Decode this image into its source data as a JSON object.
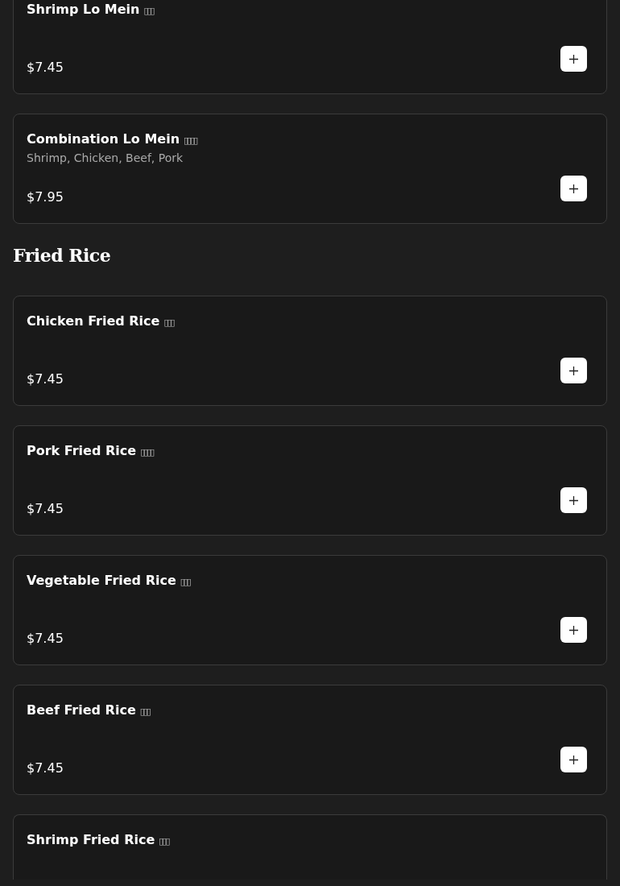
{
  "sections": [
    {
      "items": [
        {
          "name": "Shrimp Lo Mein",
          "glyph_boxes": "▯▯▯",
          "price": "$7.45"
        },
        {
          "name": "Combination Lo Mein",
          "glyph_boxes": "▯▯▯▯",
          "description": "Shrimp, Chicken, Beef, Pork",
          "price": "$7.95"
        }
      ]
    },
    {
      "heading": "Fried Rice",
      "items": [
        {
          "name": "Chicken Fried Rice",
          "glyph_boxes": "▯▯▯",
          "price": "$7.45"
        },
        {
          "name": "Pork Fried Rice",
          "glyph_boxes": "▯▯▯▯",
          "price": "$7.45"
        },
        {
          "name": "Vegetable Fried Rice",
          "glyph_boxes": "▯▯▯",
          "price": "$7.45"
        },
        {
          "name": "Beef Fried Rice",
          "glyph_boxes": "▯▯▯",
          "price": "$7.45"
        },
        {
          "name": "Shrimp Fried Rice",
          "glyph_boxes": "▯▯▯"
        }
      ]
    }
  ]
}
